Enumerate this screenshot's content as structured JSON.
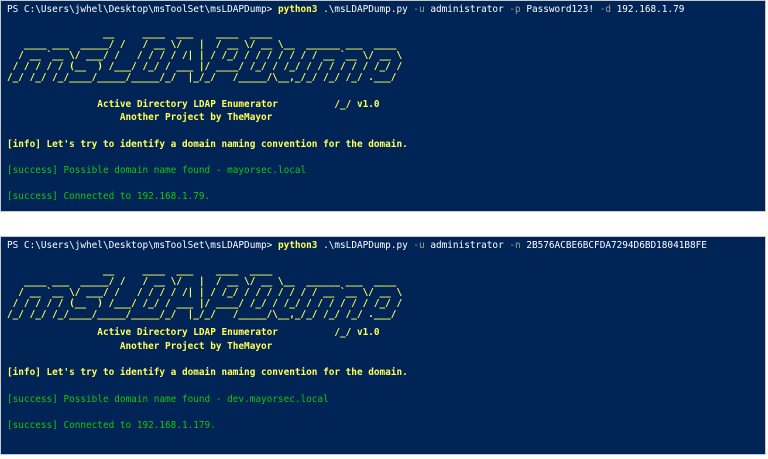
{
  "top": {
    "prompt": "PS C:\\Users\\jwhel\\Desktop\\msToolSet\\msLDAPDump> ",
    "cmd_python": "python3",
    "cmd_script": " .\\msLDAPDump.py ",
    "flag_u": "-u",
    "user": " administrator ",
    "flag_p": "-p",
    "password": " Password123! ",
    "flag_d": "-d",
    "ip": " 192.168.1.79",
    "ascii": [
      "                 __     ____  ___    ____  ____",
      "   ____ ___  _____/ /   / __ \\/   |  / __ \\/ __ \\__  ______ ___  ____",
      "  / __ `__ \\/ ___/ /   / / / / /| | / /_/ / / / / / / / __ `__ \\/ __ \\",
      " / / / / / (__  ) /___/ /_/ / ___ |/ ____/ /_/ / /_/ / / / / / / /_/ /",
      "/_/ /_/ /_/____/_____/_____/_/  |_/_/   /_____/\\__,_/_/ /_/ /_/ .___/"
    ],
    "banner1": "                Active Directory LDAP Enumerator          /_/ v1.0",
    "banner2": "                    Another Project by TheMayor",
    "info": "[info] Let's try to identify a domain naming convention for the domain.",
    "success1": "[success] Possible domain name found - mayorsec.local",
    "success2": "[success] Connected to 192.168.1.79."
  },
  "bottom": {
    "prompt": "PS C:\\Users\\jwhel\\Desktop\\msToolSet\\msLDAPDump> ",
    "cmd_python": "python3",
    "cmd_script": " .\\msLDAPDump.py ",
    "flag_u": "-u",
    "user": " administrator ",
    "flag_n": "-n",
    "hash": " 2B576ACBE6BCFDA7294D6BD18041B8FE",
    "ascii": [
      "                 __     ____  ___    ____  ____",
      "   ____ ___  _____/ /   / __ \\/   |  / __ \\/ __ \\__  ______ ___  ____",
      "  / __ `__ \\/ ___/ /   / / / / /| | / /_/ / / / / / / / __ `__ \\/ __ \\",
      " / / / / / (__  ) /___/ /_/ / ___ |/ ____/ /_/ / /_/ / / / / / / /_/ /",
      "/_/ /_/ /_/____/_____/_____/_/  |_/_/   /_____/\\__,_/_/ /_/ /_/ .___/"
    ],
    "banner1": "                Active Directory LDAP Enumerator          /_/ v1.0",
    "banner2": "                    Another Project by TheMayor",
    "info": "[info] Let's try to identify a domain naming convention for the domain.",
    "success1": "[success] Possible domain name found - dev.mayorsec.local",
    "success2": "[success] Connected to 192.168.1.179."
  }
}
